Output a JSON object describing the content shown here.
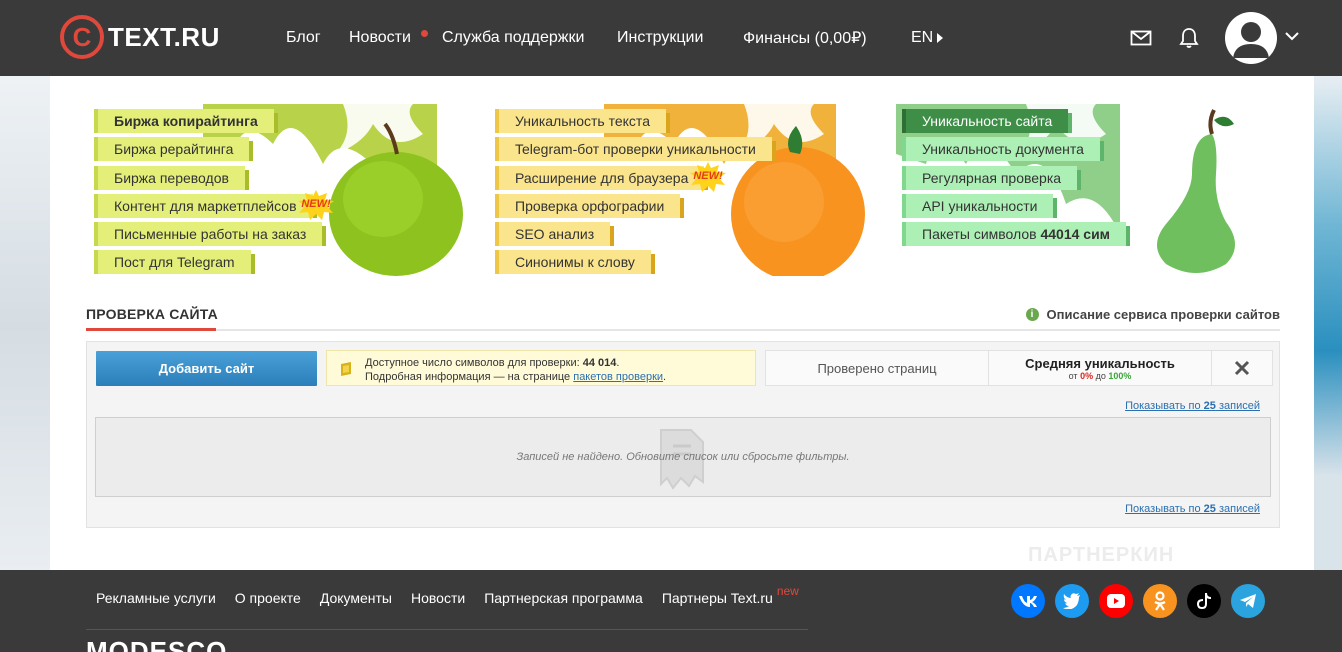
{
  "header": {
    "logo_letter": "C",
    "logo_text": "TEXT.RU",
    "nav": [
      "Блог",
      "Новости",
      "Служба поддержки",
      "Инструкции",
      "Финансы (0,00₽)"
    ],
    "lang": "EN"
  },
  "services": {
    "col1": [
      "Биржа копирайтинга",
      "Биржа рерайтинга",
      "Биржа переводов",
      "Контент для маркетплейсов",
      "Письменные работы на заказ",
      "Пост для Telegram"
    ],
    "col2": [
      "Уникальность текста",
      "Telegram-бот проверки уникальности",
      "Расширение для браузера",
      "Проверка орфографии",
      "SEO анализ",
      "Синонимы к слову"
    ],
    "col3": [
      "Уникальность сайта",
      "Уникальность документа",
      "Регулярная проверка",
      "API уникальности",
      "Пакеты символов "
    ],
    "col3_count": "44014 сим",
    "new_badge": "NEW!"
  },
  "section": {
    "title": "ПРОВЕРКА САЙТА",
    "info_link": "Описание сервиса проверки сайтов",
    "info_i": "i",
    "add_button": "Добавить сайт",
    "avail_label": "Доступное число символов для проверки: ",
    "avail_value": "44 014",
    "avail_dot": ".",
    "details_label": "Подробная информация — на странице ",
    "details_link": "пакетов проверки",
    "checked_pages": "Проверено страниц",
    "avg_label": "Средняя уникальность",
    "avg_from": "от ",
    "avg_min": "0%",
    "avg_to": " до ",
    "avg_max": "100%",
    "pager_prefix": "Показывать по ",
    "pager_count": "25",
    "pager_suffix": " записей",
    "empty_text": "Записей не найдено. Обновите список или сбросьте фильтры."
  },
  "footer": {
    "links": [
      "Рекламные услуги",
      "О проекте",
      "Документы",
      "Новости",
      "Партнерская программа",
      "Партнеры Text.ru"
    ],
    "new_label": "new",
    "social": [
      "vk",
      "twitter",
      "youtube",
      "odnoklassniki",
      "tiktok",
      "telegram"
    ],
    "social_colors": [
      "#0077ff",
      "#1d9bf0",
      "#ff0000",
      "#f7931e",
      "#000000",
      "#2aa3df"
    ],
    "brand": "MODESCO"
  },
  "watermark": "ПАРТНЕРКИН",
  "colors": {
    "accent": "#e0483b",
    "header_bg": "#3a3a3a",
    "link": "#2a6fb0",
    "button": "#2c7fba"
  }
}
